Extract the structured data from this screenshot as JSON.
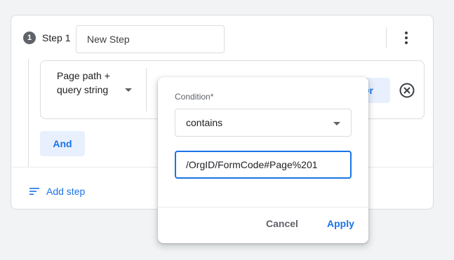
{
  "step": {
    "number": "1",
    "label": "Step 1",
    "name_value": "New Step"
  },
  "condition_row": {
    "dimension_label": "Page path + query string",
    "or_label": "Or"
  },
  "and_label": "And",
  "add_step_label": "Add step",
  "popup": {
    "condition_label": "Condition*",
    "match_type": "contains",
    "value": "/OrgID/FormCode#Page%201",
    "cancel_label": "Cancel",
    "apply_label": "Apply"
  },
  "icons": {
    "more": "more-vert-icon",
    "remove": "close-circle-icon",
    "add_step": "sort-lines-icon"
  },
  "colors": {
    "accent": "#1a73e8",
    "accent_bg": "#e8f0fe",
    "border": "#dadce0"
  }
}
